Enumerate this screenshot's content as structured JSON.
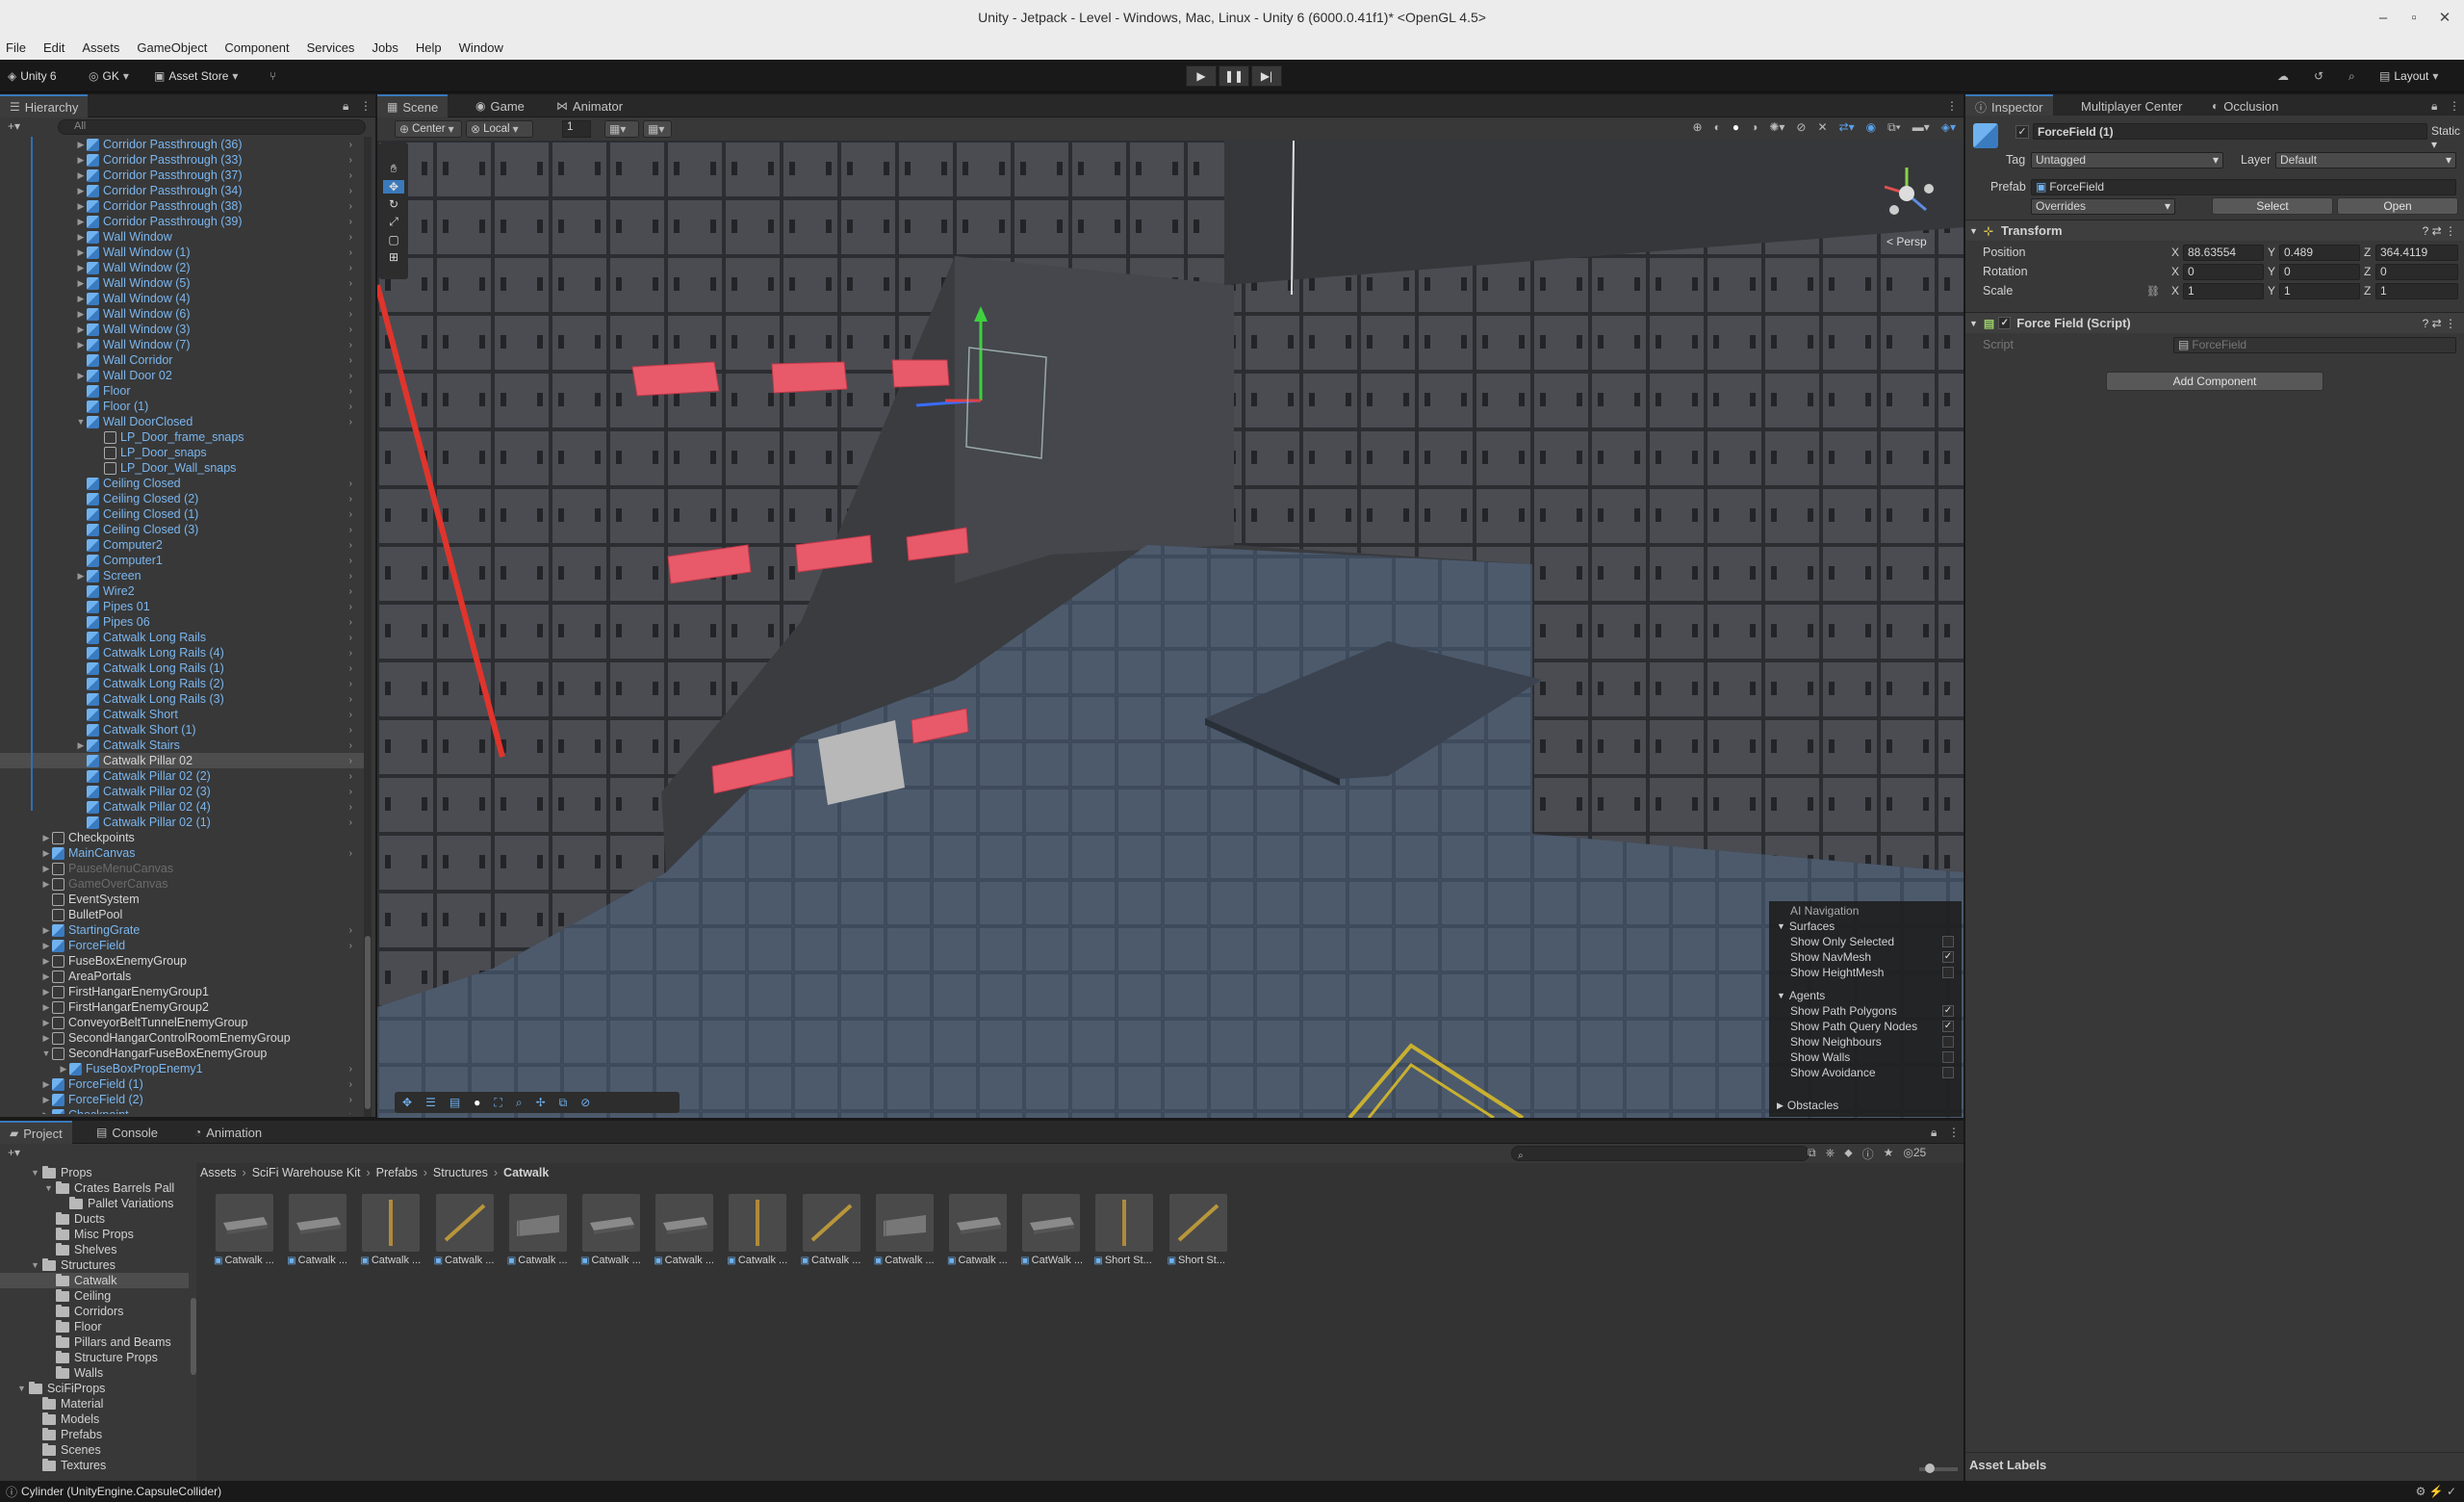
{
  "window": {
    "title": "Unity - Jetpack - Level - Windows, Mac, Linux - Unity 6 (6000.0.41f1)* <OpenGL 4.5>"
  },
  "menu": [
    "File",
    "Edit",
    "Assets",
    "GameObject",
    "Component",
    "Services",
    "Jobs",
    "Help",
    "Window"
  ],
  "toolbar": {
    "unity_label": "Unity 6",
    "account": "GK",
    "asset_store": "Asset Store",
    "layout": "Layout"
  },
  "hierarchy": {
    "tab": "Hierarchy",
    "search_placeholder": "All",
    "rows": [
      {
        "label": "Corridor Passthrough (36)",
        "style": "blue",
        "indent": 3,
        "arrow": "▶",
        "cube": "blue"
      },
      {
        "label": "Corridor Passthrough (33)",
        "style": "blue",
        "indent": 3,
        "arrow": "▶",
        "cube": "blue"
      },
      {
        "label": "Corridor Passthrough (37)",
        "style": "blue",
        "indent": 3,
        "arrow": "▶",
        "cube": "blue"
      },
      {
        "label": "Corridor Passthrough (34)",
        "style": "blue",
        "indent": 3,
        "arrow": "▶",
        "cube": "blue"
      },
      {
        "label": "Corridor Passthrough (38)",
        "style": "blue",
        "indent": 3,
        "arrow": "▶",
        "cube": "blue"
      },
      {
        "label": "Corridor Passthrough (39)",
        "style": "blue",
        "indent": 3,
        "arrow": "▶",
        "cube": "blue"
      },
      {
        "label": "Wall Window",
        "style": "blue",
        "indent": 3,
        "arrow": "▶",
        "cube": "blue"
      },
      {
        "label": "Wall Window (1)",
        "style": "blue",
        "indent": 3,
        "arrow": "▶",
        "cube": "blue"
      },
      {
        "label": "Wall Window (2)",
        "style": "blue",
        "indent": 3,
        "arrow": "▶",
        "cube": "blue"
      },
      {
        "label": "Wall Window (5)",
        "style": "blue",
        "indent": 3,
        "arrow": "▶",
        "cube": "blue"
      },
      {
        "label": "Wall Window (4)",
        "style": "blue",
        "indent": 3,
        "arrow": "▶",
        "cube": "blue"
      },
      {
        "label": "Wall Window (6)",
        "style": "blue",
        "indent": 3,
        "arrow": "▶",
        "cube": "blue"
      },
      {
        "label": "Wall Window (3)",
        "style": "blue",
        "indent": 3,
        "arrow": "▶",
        "cube": "blue"
      },
      {
        "label": "Wall Window (7)",
        "style": "blue",
        "indent": 3,
        "arrow": "▶",
        "cube": "blue"
      },
      {
        "label": "Wall Corridor",
        "style": "blue",
        "indent": 3,
        "arrow": "",
        "cube": "blue"
      },
      {
        "label": "Wall Door 02",
        "style": "blue",
        "indent": 3,
        "arrow": "▶",
        "cube": "blue"
      },
      {
        "label": "Floor",
        "style": "blue",
        "indent": 3,
        "arrow": "",
        "cube": "blue"
      },
      {
        "label": "Floor (1)",
        "style": "blue",
        "indent": 3,
        "arrow": "",
        "cube": "blue"
      },
      {
        "label": "Wall DoorClosed",
        "style": "blue",
        "indent": 3,
        "arrow": "▼",
        "cube": "blue"
      },
      {
        "label": "LP_Door_frame_snaps",
        "style": "blue",
        "indent": 4,
        "arrow": "",
        "cube": "gray"
      },
      {
        "label": "LP_Door_snaps",
        "style": "blue",
        "indent": 4,
        "arrow": "",
        "cube": "gray"
      },
      {
        "label": "LP_Door_Wall_snaps",
        "style": "blue",
        "indent": 4,
        "arrow": "",
        "cube": "gray"
      },
      {
        "label": "Ceiling Closed",
        "style": "blue",
        "indent": 3,
        "arrow": "",
        "cube": "blue"
      },
      {
        "label": "Ceiling Closed (2)",
        "style": "blue",
        "indent": 3,
        "arrow": "",
        "cube": "blue"
      },
      {
        "label": "Ceiling Closed (1)",
        "style": "blue",
        "indent": 3,
        "arrow": "",
        "cube": "blue"
      },
      {
        "label": "Ceiling Closed (3)",
        "style": "blue",
        "indent": 3,
        "arrow": "",
        "cube": "blue"
      },
      {
        "label": "Computer2",
        "style": "blue",
        "indent": 3,
        "arrow": "",
        "cube": "blue"
      },
      {
        "label": "Computer1",
        "style": "blue",
        "indent": 3,
        "arrow": "",
        "cube": "blue"
      },
      {
        "label": "Screen",
        "style": "blue",
        "indent": 3,
        "arrow": "▶",
        "cube": "blue"
      },
      {
        "label": "Wire2",
        "style": "blue",
        "indent": 3,
        "arrow": "",
        "cube": "blue"
      },
      {
        "label": "Pipes 01",
        "style": "blue",
        "indent": 3,
        "arrow": "",
        "cube": "blue"
      },
      {
        "label": "Pipes 06",
        "style": "blue",
        "indent": 3,
        "arrow": "",
        "cube": "blue"
      },
      {
        "label": "Catwalk Long Rails",
        "style": "blue",
        "indent": 3,
        "arrow": "",
        "cube": "blue"
      },
      {
        "label": "Catwalk Long Rails (4)",
        "style": "blue",
        "indent": 3,
        "arrow": "",
        "cube": "blue"
      },
      {
        "label": "Catwalk Long Rails (1)",
        "style": "blue",
        "indent": 3,
        "arrow": "",
        "cube": "blue"
      },
      {
        "label": "Catwalk Long Rails (2)",
        "style": "blue",
        "indent": 3,
        "arrow": "",
        "cube": "blue"
      },
      {
        "label": "Catwalk Long Rails (3)",
        "style": "blue",
        "indent": 3,
        "arrow": "",
        "cube": "blue"
      },
      {
        "label": "Catwalk Short",
        "style": "blue",
        "indent": 3,
        "arrow": "",
        "cube": "blue"
      },
      {
        "label": "Catwalk Short (1)",
        "style": "blue",
        "indent": 3,
        "arrow": "",
        "cube": "blue"
      },
      {
        "label": "Catwalk Stairs",
        "style": "blue",
        "indent": 3,
        "arrow": "▶",
        "cube": "blue"
      },
      {
        "label": "Catwalk Pillar 02",
        "style": "white",
        "indent": 3,
        "arrow": "",
        "cube": "blue",
        "selected": true
      },
      {
        "label": "Catwalk Pillar 02 (2)",
        "style": "blue",
        "indent": 3,
        "arrow": "",
        "cube": "blue"
      },
      {
        "label": "Catwalk Pillar 02 (3)",
        "style": "blue",
        "indent": 3,
        "arrow": "",
        "cube": "blue"
      },
      {
        "label": "Catwalk Pillar 02 (4)",
        "style": "blue",
        "indent": 3,
        "arrow": "",
        "cube": "blue"
      },
      {
        "label": "Catwalk Pillar 02 (1)",
        "style": "blue",
        "indent": 3,
        "arrow": "",
        "cube": "blue"
      },
      {
        "label": "Checkpoints",
        "style": "white",
        "indent": 1,
        "arrow": "▶",
        "cube": "gray"
      },
      {
        "label": "MainCanvas",
        "style": "blue",
        "indent": 1,
        "arrow": "▶",
        "cube": "blue"
      },
      {
        "label": "PauseMenuCanvas",
        "style": "dim",
        "indent": 1,
        "arrow": "▶",
        "cube": "gray"
      },
      {
        "label": "GameOverCanvas",
        "style": "dim",
        "indent": 1,
        "arrow": "▶",
        "cube": "gray"
      },
      {
        "label": "EventSystem",
        "style": "white",
        "indent": 1,
        "arrow": "",
        "cube": "gray"
      },
      {
        "label": "BulletPool",
        "style": "white",
        "indent": 1,
        "arrow": "",
        "cube": "gray"
      },
      {
        "label": "StartingGrate",
        "style": "blue",
        "indent": 1,
        "arrow": "▶",
        "cube": "blue"
      },
      {
        "label": "ForceField",
        "style": "blue",
        "indent": 1,
        "arrow": "▶",
        "cube": "blue"
      },
      {
        "label": "FuseBoxEnemyGroup",
        "style": "white",
        "indent": 1,
        "arrow": "▶",
        "cube": "gray"
      },
      {
        "label": "AreaPortals",
        "style": "white",
        "indent": 1,
        "arrow": "▶",
        "cube": "gray"
      },
      {
        "label": "FirstHangarEnemyGroup1",
        "style": "white",
        "indent": 1,
        "arrow": "▶",
        "cube": "gray"
      },
      {
        "label": "FirstHangarEnemyGroup2",
        "style": "white",
        "indent": 1,
        "arrow": "▶",
        "cube": "gray"
      },
      {
        "label": "ConveyorBeltTunnelEnemyGroup",
        "style": "white",
        "indent": 1,
        "arrow": "▶",
        "cube": "gray"
      },
      {
        "label": "SecondHangarControlRoomEnemyGroup",
        "style": "white",
        "indent": 1,
        "arrow": "▶",
        "cube": "gray"
      },
      {
        "label": "SecondHangarFuseBoxEnemyGroup",
        "style": "white",
        "indent": 1,
        "arrow": "▼",
        "cube": "gray"
      },
      {
        "label": "FuseBoxPropEnemy1",
        "style": "blue",
        "indent": 2,
        "arrow": "▶",
        "cube": "blue"
      },
      {
        "label": "ForceField (1)",
        "style": "blue",
        "indent": 1,
        "arrow": "▶",
        "cube": "blue"
      },
      {
        "label": "ForceField (2)",
        "style": "blue",
        "indent": 1,
        "arrow": "▶",
        "cube": "blue"
      },
      {
        "label": "Checkpoint",
        "style": "blue",
        "indent": 1,
        "arrow": "▶",
        "cube": "blue"
      }
    ]
  },
  "scene": {
    "tabs": [
      "Scene",
      "Game",
      "Animator"
    ],
    "pivot": "Center",
    "space": "Local",
    "grid_size": "1",
    "persp": "< Persp",
    "nav_overlay": {
      "title": "AI Navigation",
      "surfaces_header": "Surfaces",
      "surfaces": [
        {
          "label": "Show Only Selected",
          "checked": false
        },
        {
          "label": "Show NavMesh",
          "checked": true
        },
        {
          "label": "Show HeightMesh",
          "checked": false
        }
      ],
      "agents_header": "Agents",
      "agents": [
        {
          "label": "Show Path Polygons",
          "checked": true
        },
        {
          "label": "Show Path Query Nodes",
          "checked": true
        },
        {
          "label": "Show Neighbours",
          "checked": false
        },
        {
          "label": "Show Walls",
          "checked": false
        },
        {
          "label": "Show Avoidance",
          "checked": false
        }
      ],
      "obstacles_header": "Obstacles"
    }
  },
  "inspector": {
    "tabs": [
      "Inspector",
      "Multiplayer Center",
      "Occlusion"
    ],
    "object_name": "ForceField (1)",
    "static_label": "Static",
    "tag_label": "Tag",
    "tag_value": "Untagged",
    "layer_label": "Layer",
    "layer_value": "Default",
    "prefab_label": "Prefab",
    "prefab_value": "ForceField",
    "overrides": "Overrides",
    "select_btn": "Select",
    "open_btn": "Open",
    "transform": {
      "title": "Transform",
      "position": {
        "label": "Position",
        "x": "88.63554",
        "y": "0.489",
        "z": "364.4119"
      },
      "rotation": {
        "label": "Rotation",
        "x": "0",
        "y": "0",
        "z": "0"
      },
      "scale": {
        "label": "Scale",
        "x": "1",
        "y": "1",
        "z": "1"
      }
    },
    "script_comp": {
      "title": "Force Field (Script)",
      "script_label": "Script",
      "script_value": "ForceField"
    },
    "add_component": "Add Component",
    "asset_labels": "Asset Labels"
  },
  "project": {
    "tabs": [
      "Project",
      "Console",
      "Animation"
    ],
    "breadcrumb": [
      "Assets",
      "SciFi Warehouse Kit",
      "Prefabs",
      "Structures",
      "Catwalk"
    ],
    "count": "25",
    "tree": [
      {
        "label": "Props",
        "indent": 2,
        "arrow": "▼"
      },
      {
        "label": "Crates Barrels Pall",
        "indent": 3,
        "arrow": "▼"
      },
      {
        "label": "Pallet Variations",
        "indent": 4,
        "arrow": ""
      },
      {
        "label": "Ducts",
        "indent": 3,
        "arrow": ""
      },
      {
        "label": "Misc Props",
        "indent": 3,
        "arrow": ""
      },
      {
        "label": "Shelves",
        "indent": 3,
        "arrow": ""
      },
      {
        "label": "Structures",
        "indent": 2,
        "arrow": "▼"
      },
      {
        "label": "Catwalk",
        "indent": 3,
        "arrow": "",
        "selected": true
      },
      {
        "label": "Ceiling",
        "indent": 3,
        "arrow": ""
      },
      {
        "label": "Corridors",
        "indent": 3,
        "arrow": ""
      },
      {
        "label": "Floor",
        "indent": 3,
        "arrow": ""
      },
      {
        "label": "Pillars and Beams",
        "indent": 3,
        "arrow": ""
      },
      {
        "label": "Structure Props",
        "indent": 3,
        "arrow": ""
      },
      {
        "label": "Walls",
        "indent": 3,
        "arrow": ""
      },
      {
        "label": "SciFiProps",
        "indent": 1,
        "arrow": "▼"
      },
      {
        "label": "Material",
        "indent": 2,
        "arrow": ""
      },
      {
        "label": "Models",
        "indent": 2,
        "arrow": ""
      },
      {
        "label": "Prefabs",
        "indent": 2,
        "arrow": ""
      },
      {
        "label": "Scenes",
        "indent": 2,
        "arrow": ""
      },
      {
        "label": "Textures",
        "indent": 2,
        "arrow": ""
      }
    ],
    "assets": [
      "Catwalk ...",
      "Catwalk ...",
      "Catwalk ...",
      "Catwalk ...",
      "Catwalk ...",
      "Catwalk ...",
      "Catwalk ...",
      "Catwalk ...",
      "Catwalk ...",
      "Catwalk ...",
      "Catwalk ...",
      "CatWalk ...",
      "Short St...",
      "Short St..."
    ]
  },
  "status": {
    "text": "Cylinder (UnityEngine.CapsuleCollider)"
  }
}
